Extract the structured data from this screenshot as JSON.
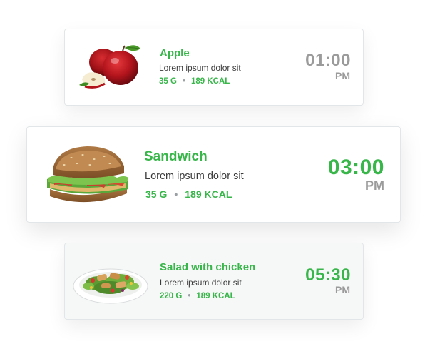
{
  "colors": {
    "accent_green": "#38b64a",
    "muted_gray": "#9b9b9b",
    "text_dark": "#3b3b3b",
    "card_border": "#e3e6e8"
  },
  "meals": [
    {
      "title": "Apple",
      "description": "Lorem ipsum dolor sit",
      "weight": "35 G",
      "separator": "•",
      "calories": "189 KCAL",
      "time": "01:00",
      "period": "PM",
      "image_icon": "apple-icon"
    },
    {
      "title": "Sandwich",
      "description": "Lorem ipsum dolor sit",
      "weight": "35 G",
      "separator": "•",
      "calories": "189 KCAL",
      "time": "03:00",
      "period": "PM",
      "image_icon": "sandwich-icon"
    },
    {
      "title": "Salad with chicken",
      "description": "Lorem ipsum dolor sit",
      "weight": "220 G",
      "separator": "•",
      "calories": "189 KCAL",
      "time": "05:30",
      "period": "PM",
      "image_icon": "salad-icon"
    }
  ]
}
